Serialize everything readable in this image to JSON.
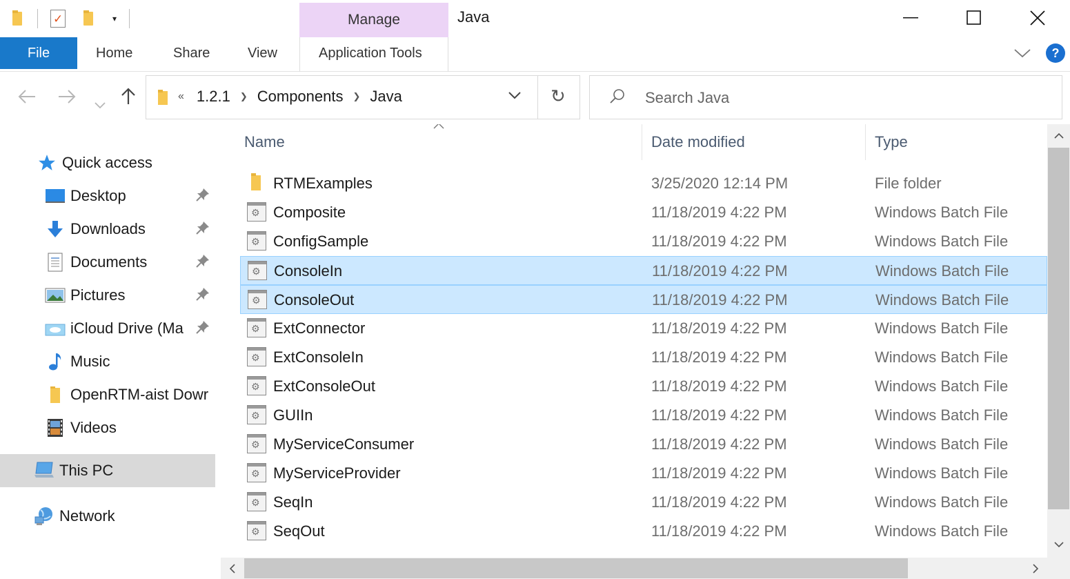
{
  "window": {
    "title": "Java",
    "contextual_tab": "Manage",
    "minimize_glyph": "—",
    "maximize_glyph": "☐",
    "close_glyph": "✕"
  },
  "quick_access_toolbar": {
    "dropdown_glyph": "▾"
  },
  "ribbon": {
    "tabs": [
      "File",
      "Home",
      "Share",
      "View",
      "Application Tools"
    ],
    "expand_glyph": "﹀",
    "help_label": "?"
  },
  "address": {
    "overflow": "«",
    "crumbs": [
      "1.2.1",
      "Components",
      "Java"
    ],
    "separator": "❯",
    "dropdown_glyph": "⌄",
    "refresh_glyph": "↻"
  },
  "search": {
    "placeholder": "Search Java"
  },
  "nav_buttons": {
    "back": "←",
    "forward": "→",
    "recent": "⌄",
    "up": "↑"
  },
  "nav_pane": {
    "quick_access": "Quick access",
    "items": [
      {
        "label": "Desktop",
        "icon": "desktop-icon",
        "pinned": true
      },
      {
        "label": "Downloads",
        "icon": "downloads-icon",
        "pinned": true
      },
      {
        "label": "Documents",
        "icon": "documents-icon",
        "pinned": true
      },
      {
        "label": "Pictures",
        "icon": "pictures-icon",
        "pinned": true
      },
      {
        "label": "iCloud Drive (Ma",
        "icon": "icloud-icon",
        "pinned": true
      },
      {
        "label": "Music",
        "icon": "music-icon",
        "pinned": false
      },
      {
        "label": "OpenRTM-aist Dowr",
        "icon": "folder-icon",
        "pinned": false
      },
      {
        "label": "Videos",
        "icon": "videos-icon",
        "pinned": false
      }
    ],
    "this_pc": "This PC",
    "network": "Network",
    "pin_glyph": "📌"
  },
  "columns": {
    "name": "Name",
    "date": "Date modified",
    "type": "Type",
    "sort_glyph": "^"
  },
  "files": [
    {
      "name": "RTMExamples",
      "date": "3/25/2020 12:14 PM",
      "type": "File folder",
      "kind": "folder",
      "selected": false
    },
    {
      "name": "Composite",
      "date": "11/18/2019 4:22 PM",
      "type": "Windows Batch File",
      "kind": "bat",
      "selected": false
    },
    {
      "name": "ConfigSample",
      "date": "11/18/2019 4:22 PM",
      "type": "Windows Batch File",
      "kind": "bat",
      "selected": false
    },
    {
      "name": "ConsoleIn",
      "date": "11/18/2019 4:22 PM",
      "type": "Windows Batch File",
      "kind": "bat",
      "selected": true
    },
    {
      "name": "ConsoleOut",
      "date": "11/18/2019 4:22 PM",
      "type": "Windows Batch File",
      "kind": "bat",
      "selected": true
    },
    {
      "name": "ExtConnector",
      "date": "11/18/2019 4:22 PM",
      "type": "Windows Batch File",
      "kind": "bat",
      "selected": false
    },
    {
      "name": "ExtConsoleIn",
      "date": "11/18/2019 4:22 PM",
      "type": "Windows Batch File",
      "kind": "bat",
      "selected": false
    },
    {
      "name": "ExtConsoleOut",
      "date": "11/18/2019 4:22 PM",
      "type": "Windows Batch File",
      "kind": "bat",
      "selected": false
    },
    {
      "name": "GUIIn",
      "date": "11/18/2019 4:22 PM",
      "type": "Windows Batch File",
      "kind": "bat",
      "selected": false
    },
    {
      "name": "MyServiceConsumer",
      "date": "11/18/2019 4:22 PM",
      "type": "Windows Batch File",
      "kind": "bat",
      "selected": false
    },
    {
      "name": "MyServiceProvider",
      "date": "11/18/2019 4:22 PM",
      "type": "Windows Batch File",
      "kind": "bat",
      "selected": false
    },
    {
      "name": "SeqIn",
      "date": "11/18/2019 4:22 PM",
      "type": "Windows Batch File",
      "kind": "bat",
      "selected": false
    },
    {
      "name": "SeqOut",
      "date": "11/18/2019 4:22 PM",
      "type": "Windows Batch File",
      "kind": "bat",
      "selected": false
    }
  ],
  "scroll": {
    "up": "⌃",
    "down": "⌄",
    "left": "‹",
    "right": "›"
  },
  "colors": {
    "accent": "#1979ca",
    "manage_tab": "#ecd4f6",
    "selection": "#cce8ff",
    "selection_border": "#99d1ff"
  }
}
